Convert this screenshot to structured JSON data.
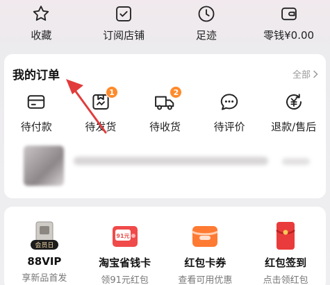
{
  "top_nav": [
    {
      "label": "收藏",
      "icon": "star-icon"
    },
    {
      "label": "订阅店铺",
      "icon": "subscribe-shop-icon"
    },
    {
      "label": "足迹",
      "icon": "clock-icon"
    },
    {
      "label": "零钱¥0.00",
      "icon": "wallet-icon"
    }
  ],
  "orders": {
    "title": "我的订单",
    "all_label": "全部",
    "statuses": [
      {
        "label": "待付款",
        "icon": "card-icon",
        "badge": ""
      },
      {
        "label": "待发货",
        "icon": "package-icon",
        "badge": "1"
      },
      {
        "label": "待收货",
        "icon": "truck-icon",
        "badge": "2"
      },
      {
        "label": "待评价",
        "icon": "chat-bubble-icon",
        "badge": ""
      },
      {
        "label": "退款/售后",
        "icon": "refund-icon",
        "badge": ""
      }
    ]
  },
  "promos": [
    {
      "name": "88VIP",
      "sub": "享新品首发",
      "badge_text": "会员日"
    },
    {
      "name": "淘宝省钱卡",
      "sub": "领91元红包",
      "badge_text": "91元"
    },
    {
      "name": "红包卡券",
      "sub": "查看可用优惠"
    },
    {
      "name": "红包签到",
      "sub": "点击领红包"
    }
  ],
  "colors": {
    "accent_orange": "#ff8a2b",
    "promo_red": "#f04a4a",
    "arrow_red": "#e23b3b"
  }
}
